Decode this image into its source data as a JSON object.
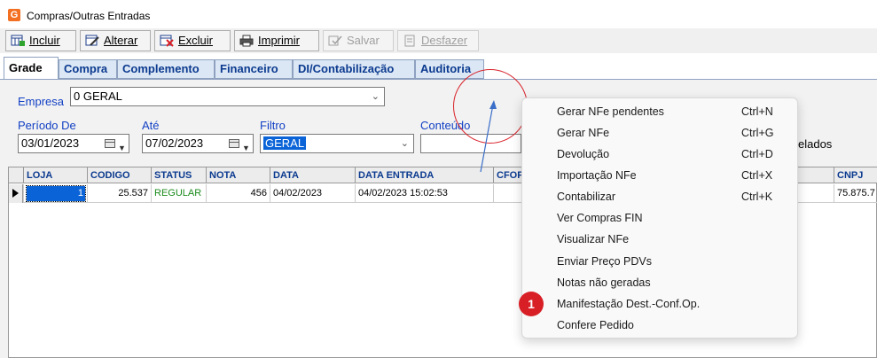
{
  "window": {
    "title": "Compras/Outras Entradas",
    "icon_letter": "G"
  },
  "toolbar": {
    "incluir": "Incluir",
    "alterar": "Alterar",
    "excluir": "Excluir",
    "imprimir": "Imprimir",
    "salvar": "Salvar",
    "desfazer": "Desfazer"
  },
  "tabs": [
    "Grade",
    "Compra",
    "Complemento",
    "Financeiro",
    "DI/Contabilização",
    "Auditoria"
  ],
  "filters": {
    "empresa_label": "Empresa",
    "empresa_value": "0 GERAL",
    "periodo_label": "Período De",
    "periodo_value": "03/01/2023",
    "ate_label": "Até",
    "ate_value": "07/02/2023",
    "filtro_label": "Filtro",
    "filtro_value": "GERAL",
    "conteudo_label": "Conteúdo",
    "partial_text": "elados"
  },
  "grid": {
    "columns": [
      "LOJA",
      "CODIGO",
      "STATUS",
      "NOTA",
      "DATA",
      "DATA ENTRADA",
      "CFOP",
      "CNPJ"
    ],
    "rows": [
      {
        "loja": "1",
        "codigo": "25.537",
        "status": "REGULAR",
        "nota": "456",
        "data": "04/02/2023",
        "data_entrada": "04/02/2023 15:02:53",
        "cnpj": "75.875.7"
      }
    ]
  },
  "context_menu": {
    "items": [
      {
        "label": "Gerar NFe pendentes",
        "shortcut": "Ctrl+N"
      },
      {
        "label": "Gerar NFe",
        "shortcut": "Ctrl+G"
      },
      {
        "label": "Devolução",
        "shortcut": "Ctrl+D"
      },
      {
        "label": "Importação NFe",
        "shortcut": "Ctrl+X"
      },
      {
        "label": "Contabilizar",
        "shortcut": "Ctrl+K"
      },
      {
        "label": "Ver Compras FIN",
        "shortcut": ""
      },
      {
        "label": "Visualizar NFe",
        "shortcut": ""
      },
      {
        "label": "Enviar Preço PDVs",
        "shortcut": ""
      },
      {
        "label": "Notas não geradas",
        "shortcut": ""
      },
      {
        "label": "Manifestação Dest.-Conf.Op.",
        "shortcut": ""
      },
      {
        "label": "Confere Pedido",
        "shortcut": ""
      }
    ]
  },
  "annotation": {
    "badge_number": "1"
  },
  "colors": {
    "label_blue": "#1240c4",
    "tab_text": "#0b3a8f",
    "status_green": "#1a8a1a",
    "selection": "#0a64d8",
    "annotation_red": "#d81f26"
  }
}
